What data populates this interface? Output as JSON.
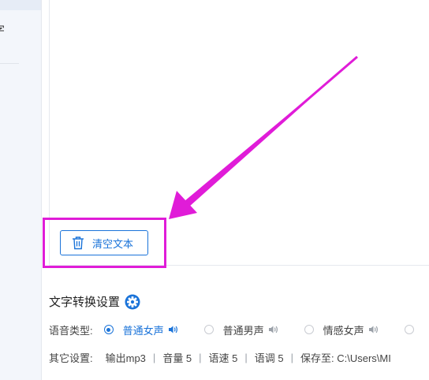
{
  "sidebar": {
    "partial_label": "字"
  },
  "text_panel": {
    "clear_button_label": "清空文本"
  },
  "settings": {
    "title": "文字转换设置",
    "voice_type": {
      "label": "语音类型:",
      "options": [
        {
          "label": "普通女声",
          "selected": true
        },
        {
          "label": "普通男声",
          "selected": false
        },
        {
          "label": "情感女声",
          "selected": false
        }
      ]
    },
    "other": {
      "label": "其它设置:",
      "output": "输出mp3",
      "volume": "音量 5",
      "speed": "语速 5",
      "pitch": "语调 5",
      "save_path": "保存至: C:\\Users\\MI"
    }
  },
  "colors": {
    "accent": "#1a73d9",
    "highlight": "#e01cd8"
  },
  "icons": {
    "clear": "trash-icon",
    "settings": "gear-icon",
    "voice_preview": "speaker-icon"
  }
}
